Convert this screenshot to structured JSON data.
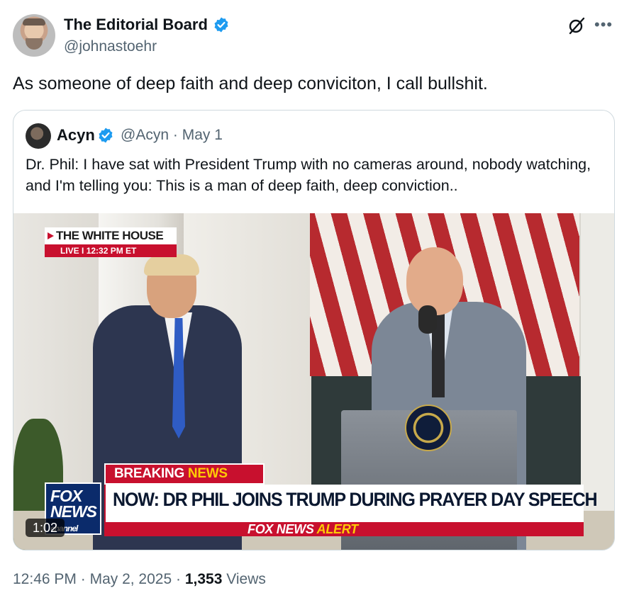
{
  "author": {
    "name": "The Editorial Board",
    "handle": "@johnastoehr"
  },
  "tweet": {
    "text": "As someone of deep faith and deep conviciton, I call bullshit."
  },
  "quoted": {
    "name": "Acyn",
    "handle": "@Acyn",
    "separator": "·",
    "date": "May 1",
    "text": "Dr. Phil: I have sat with President Trump with no cameras around, nobody watching, and I'm telling you: This is a man of deep faith, deep conviction.."
  },
  "video": {
    "location_label": "THE WHITE HOUSE",
    "live_label": "LIVE",
    "live_time": "12:32 PM ET",
    "breaking_word": "BREAKING",
    "news_word": "NEWS",
    "headline": "NOW: DR PHIL JOINS TRUMP DURING PRAYER DAY SPEECH",
    "alert_brand": "FOX NEWS",
    "alert_word": "ALERT",
    "logo_line1": "FOX",
    "logo_line2": "NEWS",
    "logo_line3": "channel",
    "duration": "1:02"
  },
  "footer": {
    "time": "12:46 PM",
    "separator": "·",
    "date": "May 2, 2025",
    "views_count": "1,353",
    "views_label": "Views"
  },
  "colors": {
    "verified": "#1d9bf0",
    "secondary_text": "#536471",
    "fox_red": "#c8102e",
    "fox_yellow": "#ffcb05"
  },
  "icons": [
    "verified-badge-icon",
    "grok-icon",
    "more-icon"
  ]
}
